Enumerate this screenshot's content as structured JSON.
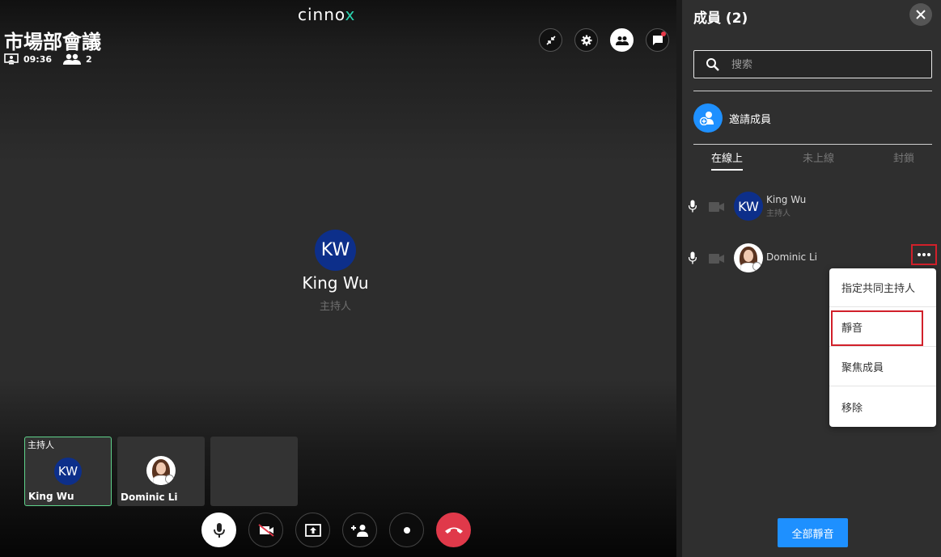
{
  "app": {
    "logo": "cinno",
    "logo_x": "x",
    "brand_color": "#2bd4b0"
  },
  "meeting": {
    "title": "市場部會議",
    "duration": "09:36",
    "participants": "2"
  },
  "speaker": {
    "initials": "KW",
    "name": "King Wu",
    "role": "主持人"
  },
  "tiles": [
    {
      "role": "主持人",
      "initials": "KW",
      "name": "King Wu"
    },
    {
      "name": "Dominic Li"
    }
  ],
  "panel": {
    "title": "成員 (2)",
    "search_placeholder": "搜索",
    "invite_label": "邀請成員",
    "tabs": [
      "在線上",
      "未上線",
      "封鎖"
    ],
    "members": [
      {
        "initials": "KW",
        "name": "King Wu",
        "role": "主持人"
      },
      {
        "name": "Dominic Li"
      }
    ],
    "menu": [
      "指定共同主持人",
      "靜音",
      "聚焦成員",
      "移除"
    ],
    "mute_all": "全部靜音"
  },
  "colors": {
    "accent": "#1e90ff",
    "danger": "#e0394a",
    "highlight": "#d1202a",
    "host_border": "#5fd38b"
  }
}
